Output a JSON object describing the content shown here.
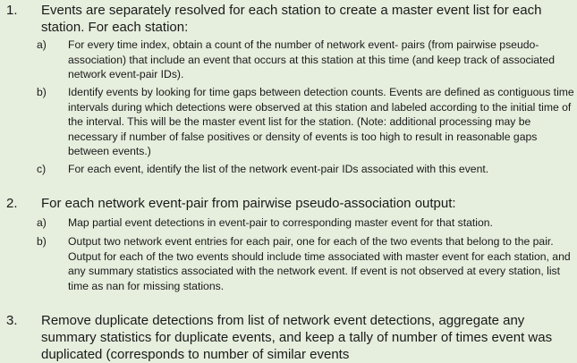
{
  "steps": [
    {
      "number": "1.",
      "text": "Events are separately resolved for each station to create a master event list for each station. For each station:",
      "subitems": [
        {
          "letter": "a)",
          "text": "For every time index, obtain a count of the number of network event- pairs (from pairwise pseudo-association) that include an event that occurs at this station at this time (and keep track of associated network event-pair IDs)."
        },
        {
          "letter": "b)",
          "text": "Identify events by looking for time gaps between detection counts. Events are defined as contiguous time intervals during which detections were observed at this station and labeled according to the initial time of the interval. This will be the master event list for the station. (Note: additional processing may be necessary if number of false positives or density of events is too high to result in reasonable gaps between events.)"
        },
        {
          "letter": "c)",
          "text": "For each event, identify the list of the network event-pair IDs associated with this event."
        }
      ]
    },
    {
      "number": "2.",
      "text": "For each network event-pair from pairwise pseudo-association output:",
      "subitems": [
        {
          "letter": "a)",
          "text": "Map partial event detections in event-pair to corresponding master event for that station."
        },
        {
          "letter": "b)",
          "text": "Output two network event entries for each pair, one for each of the two events that belong to the pair. Output for each of the two events should include time associated with master event for each station, and any summary statistics associated with the network event. If event is not observed at every station, list time as nan for missing stations."
        }
      ]
    },
    {
      "number": "3.",
      "text": "Remove duplicate detections from list of network event detections, aggregate any summary statistics for duplicate events, and keep a tally of number of times event was duplicated (corresponds to number of similar events",
      "subitems": []
    }
  ]
}
